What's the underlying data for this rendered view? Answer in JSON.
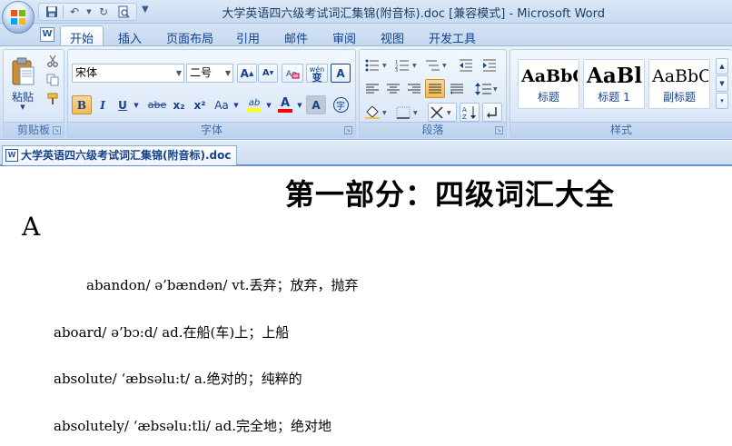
{
  "window": {
    "title": "大学英语四六级考试词汇集锦(附音标).doc [兼容模式] - Microsoft Word"
  },
  "quick_access": {
    "save_icon": "save-icon",
    "undo_icon": "undo-icon",
    "redo_icon": "redo-icon"
  },
  "ribbon": {
    "tabs": [
      "开始",
      "插入",
      "页面布局",
      "引用",
      "邮件",
      "审阅",
      "视图",
      "开发工具"
    ],
    "active_tab": "开始",
    "clipboard": {
      "label": "剪贴板",
      "paste_label": "粘贴"
    },
    "font": {
      "label": "字体",
      "font_name": "宋体",
      "font_size": "二号",
      "grow_label": "A",
      "shrink_label": "A",
      "bold": "B",
      "italic": "I",
      "underline": "U",
      "strike": "abe",
      "subscript": "x₂",
      "superscript": "x²",
      "change_case": "Aa",
      "highlight": "ab",
      "font_color": "A",
      "char_shading": "A",
      "phonetic_label": "wén",
      "phonetic_char": "变",
      "char_border": "A",
      "enclose_char": "字"
    },
    "paragraph": {
      "label": "段落"
    },
    "styles": {
      "label": "样式",
      "items": [
        {
          "sample": "AaBbC",
          "name": "标题"
        },
        {
          "sample": "AaBl",
          "name": "标题 1"
        },
        {
          "sample": "AaBbC",
          "name": "副标题"
        }
      ]
    }
  },
  "document_tab": {
    "name": "大学英语四六级考试词汇集锦(附音标).doc"
  },
  "document": {
    "heading": "第一部分：四级词汇大全",
    "section_letter": "A",
    "entries": [
      "abandon/ ə’bændən/ vt.丢弃；放弃，抛弃",
      "aboard/ ə’bɔ:d/ ad.在船(车)上；上船",
      "absolute/ ‘æbsəlu:t/ a.绝对的；纯粹的",
      "absolutely/ ‘æbsəlu:tli/ ad.完全地；绝对地"
    ]
  }
}
